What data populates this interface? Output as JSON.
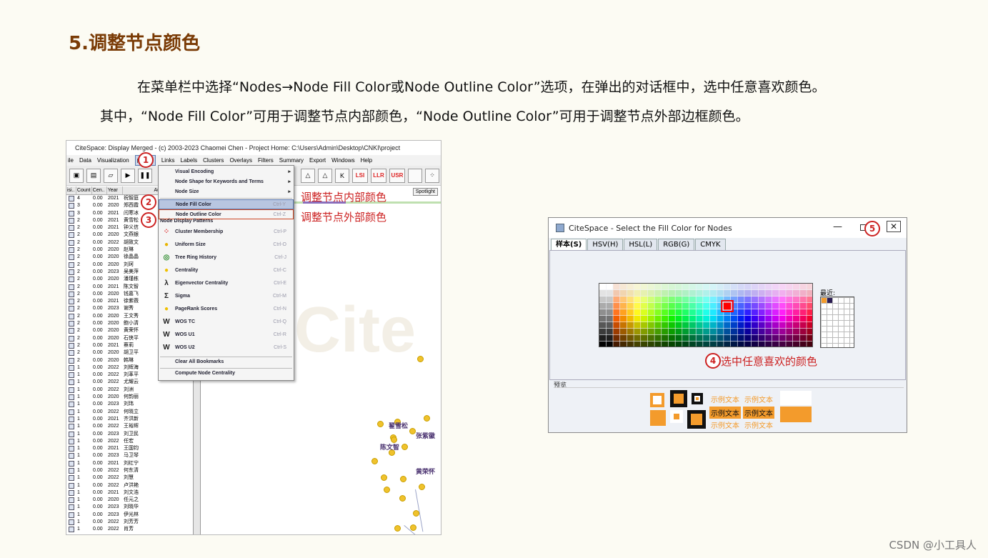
{
  "title": "5.调整节点颜色",
  "paragraph1": "在菜单栏中选择“Nodes→Node Fill Color或Node Outline Color”选项，在弹出的对话框中，选中任意喜欢颜色。",
  "paragraph2": "其中，“Node Fill Color”可用于调整节点内部颜色，“Node Outline Color”可用于调整节点外部边框颜色。",
  "watermark": "CSDN @小工具人",
  "citespace": {
    "window_title": "CiteSpace: Display Merged - (c) 2003-2023 Chaomei Chen - Project Home: C:\\Users\\Admin\\Desktop\\CNKI\\project",
    "menubar": [
      "ile",
      "Data",
      "Visualization",
      "Nodes",
      "Links",
      "Labels",
      "Clusters",
      "Overlays",
      "Filters",
      "Summary",
      "Export",
      "Windows",
      "Help"
    ],
    "toolbar": [
      "LSI",
      "LLR",
      "USR"
    ],
    "spotlight": "Spotlight",
    "table_headers": [
      "isi..",
      "Count",
      "Cen..",
      "Year",
      "Aut"
    ],
    "rows": [
      [
        "4",
        "0.00",
        "2021",
        "祝智庭"
      ],
      [
        "3",
        "0.00",
        "2020",
        "郑西霞"
      ],
      [
        "3",
        "0.00",
        "2021",
        "闫寒冰"
      ],
      [
        "2",
        "0.00",
        "2021",
        "黄雪松"
      ],
      [
        "2",
        "0.00",
        "2021",
        "钟义信"
      ],
      [
        "2",
        "0.00",
        "2020",
        "文燕银"
      ],
      [
        "2",
        "0.00",
        "2022",
        "胡致文"
      ],
      [
        "2",
        "0.00",
        "2020",
        "赵琳"
      ],
      [
        "2",
        "0.00",
        "2020",
        "徐晶晶"
      ],
      [
        "2",
        "0.00",
        "2020",
        "刘珂"
      ],
      [
        "2",
        "0.00",
        "2023",
        "吴美萍"
      ],
      [
        "2",
        "0.00",
        "2020",
        "潘瑾栋"
      ],
      [
        "2",
        "0.00",
        "2021",
        "陈文智"
      ],
      [
        "2",
        "0.00",
        "2020",
        "钱嘉飞"
      ],
      [
        "2",
        "0.00",
        "2021",
        "徐紫薇"
      ],
      [
        "2",
        "0.00",
        "2023",
        "谢秀"
      ],
      [
        "2",
        "0.00",
        "2020",
        "王文秀"
      ],
      [
        "2",
        "0.00",
        "2020",
        "鲍小清"
      ],
      [
        "2",
        "0.00",
        "2020",
        "黄荣怀"
      ],
      [
        "2",
        "0.00",
        "2020",
        "石侠平"
      ],
      [
        "2",
        "0.00",
        "2021",
        "蔡莉"
      ],
      [
        "2",
        "0.00",
        "2020",
        "胡卫平"
      ],
      [
        "2",
        "0.00",
        "2020",
        "韩琳"
      ],
      [
        "1",
        "0.00",
        "2022",
        "刘辉海"
      ],
      [
        "1",
        "0.00",
        "2022",
        "刘革平"
      ],
      [
        "1",
        "0.00",
        "2022",
        "尤耀云"
      ],
      [
        "1",
        "0.00",
        "2022",
        "刘洲"
      ],
      [
        "1",
        "0.00",
        "2020",
        "何韵丽"
      ],
      [
        "1",
        "0.00",
        "2023",
        "刘玮"
      ],
      [
        "1",
        "0.00",
        "2022",
        "何晓立"
      ],
      [
        "1",
        "0.00",
        "2021",
        "齐洪新"
      ],
      [
        "1",
        "0.00",
        "2022",
        "王裕辉"
      ],
      [
        "1",
        "0.00",
        "2023",
        "刘卫民"
      ],
      [
        "1",
        "0.00",
        "2022",
        "任宏"
      ],
      [
        "1",
        "0.00",
        "2021",
        "王国钧"
      ],
      [
        "1",
        "0.00",
        "2023",
        "马卫琴"
      ],
      [
        "1",
        "0.00",
        "2021",
        "刘红宁"
      ],
      [
        "1",
        "0.00",
        "2022",
        "何东清"
      ],
      [
        "1",
        "0.00",
        "2022",
        "刘慧"
      ],
      [
        "1",
        "0.00",
        "2022",
        "卢洪艳"
      ],
      [
        "1",
        "0.00",
        "2021",
        "刘文浩"
      ],
      [
        "1",
        "0.00",
        "2020",
        "任元之"
      ],
      [
        "1",
        "0.00",
        "2023",
        "刘晓华"
      ],
      [
        "1",
        "0.00",
        "2023",
        "伊光林"
      ],
      [
        "1",
        "0.00",
        "2022",
        "刘芳芳"
      ],
      [
        "1",
        "0.00",
        "2022",
        "肖芳"
      ]
    ],
    "node_labels": [
      "翟雪松",
      "张紫徽",
      "陈文智",
      "黄荣怀"
    ],
    "menu": {
      "items_top": [
        {
          "label": "Visual Encoding",
          "arrow": "▸"
        },
        {
          "label": "Node Shape for Keywords and Terms",
          "arrow": "▸"
        },
        {
          "label": "Node Size",
          "arrow": "▸"
        }
      ],
      "fill": {
        "label": "Node Fill Color",
        "shortcut": "Ctrl-Y"
      },
      "outline": {
        "label": "Node Outline Color",
        "shortcut": "Ctrl-Z"
      },
      "patterns_header": "Node Display Patterns",
      "patterns": [
        {
          "label": "Cluster Membership",
          "shortcut": "Ctrl-P",
          "icon": "cluster-icon"
        },
        {
          "label": "Uniform Size",
          "shortcut": "Ctrl-O",
          "icon": "uniform-icon"
        },
        {
          "label": "Tree Ring History",
          "shortcut": "Ctrl-J",
          "icon": "tree-ring-icon"
        },
        {
          "label": "Centrality",
          "shortcut": "Ctrl-C",
          "icon": "centrality-icon"
        },
        {
          "label": "Eigenvector Centrality",
          "shortcut": "Ctrl-E",
          "icon": "lambda-icon"
        },
        {
          "label": "Sigma",
          "shortcut": "Ctrl-M",
          "icon": "sigma-icon"
        },
        {
          "label": "PageRank Scores",
          "shortcut": "Ctrl-N",
          "icon": "pagerank-icon"
        },
        {
          "label": "WOS TC",
          "shortcut": "Ctrl-Q",
          "icon": "wos-icon"
        },
        {
          "label": "WOS U1",
          "shortcut": "Ctrl-R",
          "icon": "wos-icon"
        },
        {
          "label": "WOS U2",
          "shortcut": "Ctrl-S",
          "icon": "wos-icon"
        }
      ],
      "clear_bookmarks": "Clear All Bookmarks",
      "compute": "Compute Node Centrality"
    }
  },
  "annotations": {
    "badge1": "1",
    "badge2": "2",
    "badge3": "3",
    "badge4": "4",
    "badge5": "5",
    "fill_note": "调整节点内部颜色",
    "outline_note": "调整节点外部颜色",
    "swatch_note": "选中任意喜欢的颜色"
  },
  "dialog": {
    "title": "CiteSpace - Select the Fill Color for Nodes",
    "minimize": "—",
    "close": "✕",
    "tabs": [
      "样本(S)",
      "HSV(H)",
      "HSL(L)",
      "RGB(G)",
      "CMYK"
    ],
    "recent_label": "最近:",
    "preview_label": "预览",
    "sample_text": "示例文本",
    "selected_color": "#ff0000",
    "accent_color": "#f39b2c"
  }
}
